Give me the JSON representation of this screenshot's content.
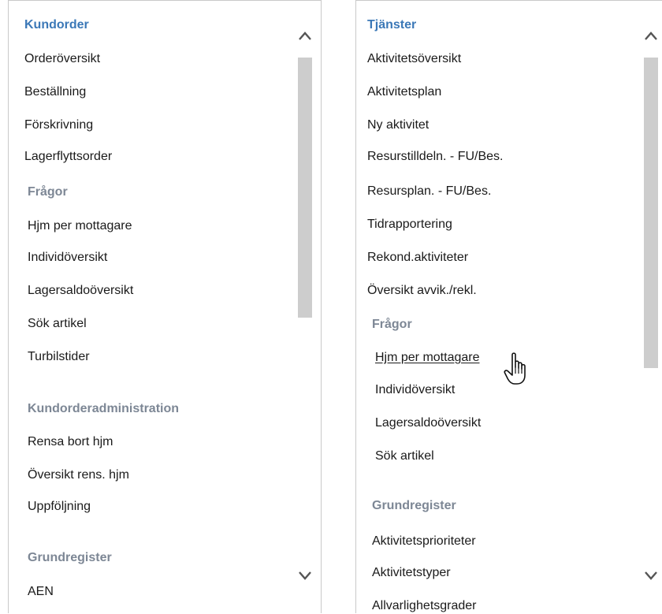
{
  "left_panel": {
    "sections": [
      {
        "heading": "Kundorder",
        "items": [
          "Orderöversikt",
          "Beställning",
          "Förskrivning",
          "Lagerflyttsorder"
        ]
      },
      {
        "heading": "Frågor",
        "items": [
          "Hjm per mottagare",
          "Individöversikt",
          "Lagersaldoöversikt",
          "Sök artikel",
          "Turbilstider"
        ]
      },
      {
        "heading": "Kundorderadministration",
        "items": [
          "Rensa bort hjm",
          "Översikt rens. hjm",
          "Uppföljning"
        ]
      },
      {
        "heading": "Grundregister",
        "items": [
          "AEN"
        ]
      }
    ]
  },
  "right_panel": {
    "sections": [
      {
        "heading": "Tjänster",
        "items": [
          "Aktivitetsöversikt",
          "Aktivitetsplan",
          "Ny aktivitet",
          "Resurstilldeln. - FU/Bes.",
          "Resursplan. - FU/Bes.",
          "Tidrapportering",
          "Rekond.aktiviteter",
          "Översikt avvik./rekl."
        ]
      },
      {
        "heading": "Frågor",
        "items": [
          "Hjm per mottagare",
          "Individöversikt",
          "Lagersaldoöversikt",
          "Sök artikel"
        ]
      },
      {
        "heading": "Grundregister",
        "items": [
          "Aktivitetsprioriteter",
          "Aktivitetstyper",
          "Allvarlighetsgrader"
        ]
      }
    ]
  },
  "icons": {
    "scroll_up": "chevron-up-icon",
    "scroll_down": "chevron-down-icon",
    "cursor": "hand-pointer-icon"
  },
  "colors": {
    "main_heading": "#3b78b7",
    "sub_heading": "#7d8795",
    "item_text": "#1a1a1a",
    "scroll_thumb": "#cdcdcd",
    "panel_border": "#c9c9c9"
  }
}
